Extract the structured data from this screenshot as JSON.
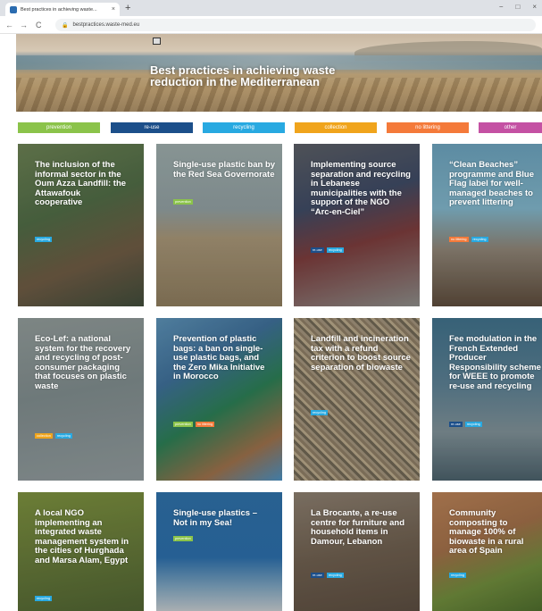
{
  "browser": {
    "tab_title": "Best practices in achieving waste...",
    "tab_close": "×",
    "new_tab": "+",
    "url": "bestpractices.waste-med.eu",
    "nav_back": "←",
    "nav_forward": "→",
    "nav_reload": "C",
    "lock": "🔒",
    "min": "−",
    "max": "□",
    "close": "×"
  },
  "hero": {
    "title": "Best practices in achieving waste reduction in the Mediterranean"
  },
  "categories": [
    {
      "label": "prevention",
      "color": "#8bc34a"
    },
    {
      "label": "re-use",
      "color": "#1c4f8a"
    },
    {
      "label": "recycling",
      "color": "#28a9e1"
    },
    {
      "label": "collection",
      "color": "#f0a41c"
    },
    {
      "label": "no littering",
      "color": "#f47a3a"
    },
    {
      "label": "other",
      "color": "#c451a3"
    }
  ],
  "cards": [
    {
      "title": "The inclusion of the informal sector in the Oum Azza Landfill: the Attawafouk cooperative",
      "tags": [
        "recycling"
      ]
    },
    {
      "title": "Single-use plastic ban by the Red Sea Governorate",
      "tags": [
        "prevention"
      ]
    },
    {
      "title": "Implementing source separation and recycling in Lebanese municipalities with the support of the NGO “Arc-en-Ciel”",
      "tags": [
        "re-use",
        "recycling"
      ]
    },
    {
      "title": "“Clean Beaches” programme and Blue Flag label for well-managed beaches to prevent littering",
      "tags": [
        "no littering",
        "recycling"
      ]
    },
    {
      "title": "Eco-Lef: a national system for the recovery and recycling of post-consumer packaging that focuses on plastic waste",
      "tags": [
        "collection",
        "recycling"
      ]
    },
    {
      "title": "Prevention of plastic bags: a ban on single-use plastic bags, and the Zero Mika Initiative in Morocco",
      "tags": [
        "prevention",
        "no littering"
      ]
    },
    {
      "title": "Landfill and incineration tax with a refund criterion to boost source separation of biowaste",
      "tags": [
        "recycling"
      ]
    },
    {
      "title": "Fee modulation in the French Extended Producer Responsibility scheme for WEEE to promote re-use and recycling",
      "tags": [
        "re-use",
        "recycling"
      ]
    },
    {
      "title": "A local NGO implementing an integrated waste management system in the cities of Hurghada and Marsa Alam, Egypt",
      "tags": [
        "recycling"
      ]
    },
    {
      "title": "Single-use plastics – Not in my Sea!",
      "tags": [
        "prevention"
      ]
    },
    {
      "title": "La Brocante, a re-use centre for furniture and household items in Damour, Lebanon",
      "tags": [
        "re-use",
        "recycling"
      ]
    },
    {
      "title": "Community composting to manage 100% of biowaste in a rural area of Spain",
      "tags": [
        "recycling"
      ]
    }
  ]
}
